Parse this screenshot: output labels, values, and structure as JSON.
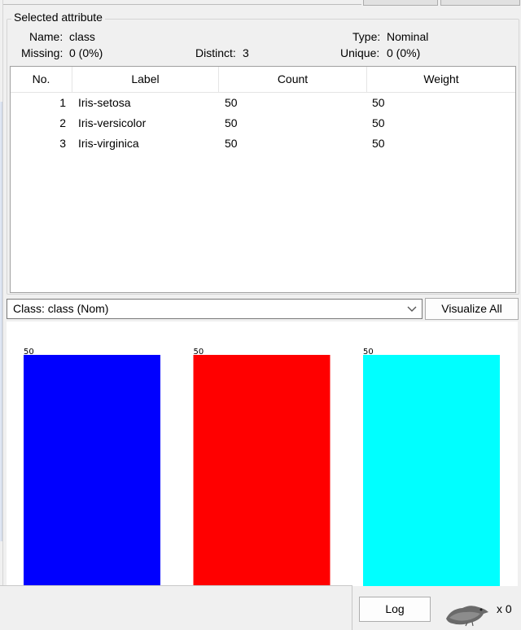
{
  "selected_attribute": {
    "title": "Selected attribute",
    "name_label": "Name:",
    "name_value": "class",
    "type_label": "Type:",
    "type_value": "Nominal",
    "missing_label": "Missing:",
    "missing_value": "0 (0%)",
    "distinct_label": "Distinct:",
    "distinct_value": "3",
    "unique_label": "Unique:",
    "unique_value": "0 (0%)"
  },
  "table": {
    "columns": [
      "No.",
      "Label",
      "Count",
      "Weight"
    ],
    "rows": [
      {
        "no": "1",
        "label": "Iris-setosa",
        "count": "50",
        "weight": "50"
      },
      {
        "no": "2",
        "label": "Iris-versicolor",
        "count": "50",
        "weight": "50"
      },
      {
        "no": "3",
        "label": "Iris-virginica",
        "count": "50",
        "weight": "50"
      }
    ]
  },
  "class_selector": {
    "value": "Class: class (Nom)"
  },
  "visualize_all_label": "Visualize All",
  "log_button_label": "Log",
  "status": {
    "count_text": "x 0"
  },
  "icons": {
    "combo_arrow": "chevron-down-icon",
    "status_bird": "weka-bird-icon"
  },
  "chart_data": {
    "type": "bar",
    "categories": [
      "Iris-setosa",
      "Iris-versicolor",
      "Iris-virginica"
    ],
    "values": [
      50,
      50,
      50
    ],
    "data_labels": [
      "50",
      "50",
      "50"
    ],
    "colors": [
      "#0000ff",
      "#ff0000",
      "#00ffff"
    ],
    "ylim": [
      0,
      50
    ]
  }
}
